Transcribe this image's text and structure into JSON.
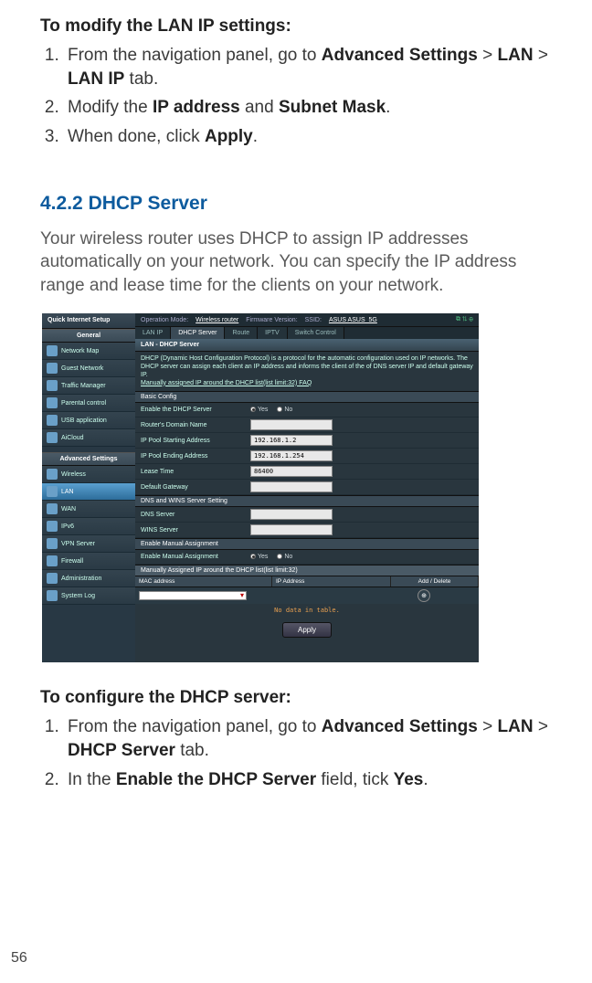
{
  "pageNumber": "56",
  "section1": {
    "heading": "To modify the LAN IP settings:",
    "steps": [
      {
        "pre": "From the navigation panel, go to ",
        "b1": "Advanced Settings",
        "gt": " > ",
        "b2": "LAN",
        "gt2": " > ",
        "b3": "LAN IP",
        "post": " tab."
      },
      {
        "pre": "Modify the ",
        "b1": "IP address",
        "mid": " and ",
        "b2": "Subnet Mask",
        "post": "."
      },
      {
        "pre": "When done, click ",
        "b1": "Apply",
        "post": "."
      }
    ]
  },
  "subsection": {
    "num": "4.2.2",
    "title": "DHCP Server",
    "intro": "Your wireless router uses DHCP to assign IP addresses automatically on your network. You can specify the IP address range and lease time for the clients on your network."
  },
  "router": {
    "qis": "Quick Internet Setup",
    "generalHead": "General",
    "advHead": "Advanced Settings",
    "general": [
      "Network Map",
      "Guest Network",
      "Traffic Manager",
      "Parental control",
      "USB application",
      "AiCloud"
    ],
    "advanced": [
      "Wireless",
      "LAN",
      "WAN",
      "IPv6",
      "VPN Server",
      "Firewall",
      "Administration",
      "System Log"
    ],
    "activeAdv": "LAN",
    "topbar": {
      "opmodeLabel": "Operation Mode:",
      "opmode": "Wireless router",
      "fwLabel": "Firmware Version:",
      "ssidLabel": "SSID:",
      "ssid": "ASUS ASUS_5G"
    },
    "tabs": [
      "LAN IP",
      "DHCP Server",
      "Route",
      "IPTV",
      "Switch Control"
    ],
    "activeTab": "DHCP Server",
    "panelTitle": "LAN - DHCP Server",
    "panelDesc": "DHCP (Dynamic Host Configuration Protocol) is a protocol for the automatic configuration used on IP networks. The DHCP server can assign each client an IP address and informs the client of the of DNS server IP and default gateway IP.",
    "panelLink": "Manually assigned IP around the DHCP list(list limit:32) FAQ",
    "basicHead": "Basic Config",
    "rows": {
      "enable": {
        "label": "Enable the DHCP Server",
        "yes": "Yes",
        "no": "No"
      },
      "domain": {
        "label": "Router's Domain Name",
        "value": ""
      },
      "start": {
        "label": "IP Pool Starting Address",
        "value": "192.168.1.2"
      },
      "end": {
        "label": "IP Pool Ending Address",
        "value": "192.168.1.254"
      },
      "lease": {
        "label": "Lease Time",
        "value": "86400"
      },
      "gw": {
        "label": "Default Gateway",
        "value": ""
      }
    },
    "dnsHead": "DNS and WINS Server Setting",
    "dns": {
      "label": "DNS Server",
      "value": ""
    },
    "wins": {
      "label": "WINS Server",
      "value": ""
    },
    "manHead": "Enable Manual Assignment",
    "manRow": {
      "label": "Enable Manual Assignment",
      "yes": "Yes",
      "no": "No"
    },
    "tableHead": "Manually Assigned IP around the DHCP list(list limit:32)",
    "cols": {
      "mac": "MAC address",
      "ip": "IP Address",
      "add": "Add / Delete"
    },
    "nodata": "No data in table.",
    "apply": "Apply"
  },
  "section2": {
    "heading": "To configure the DHCP server:",
    "steps": [
      {
        "pre": "From the navigation panel, go to ",
        "b1": "Advanced Settings",
        "gt": " > ",
        "b2": "LAN",
        "gt2": " > ",
        "b3": "DHCP Server",
        "post": " tab."
      },
      {
        "pre": "In the ",
        "b1": "Enable the DHCP Server",
        "mid": " field, tick ",
        "b2": "Yes",
        "post": "."
      }
    ]
  }
}
